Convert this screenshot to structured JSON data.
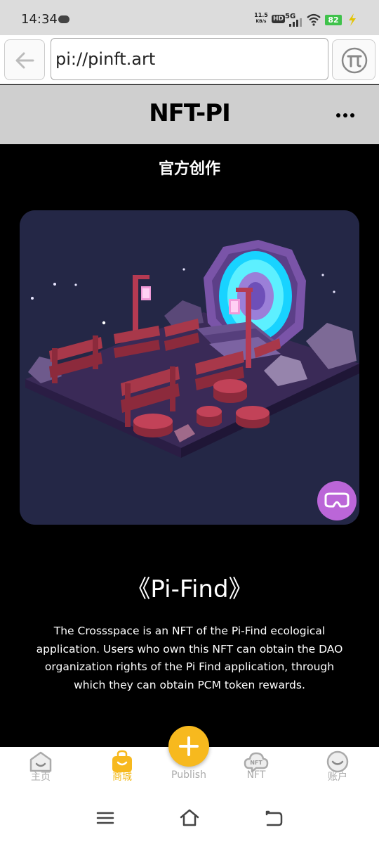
{
  "status_bar": {
    "time": "14:34",
    "net_speed": "11.5",
    "net_unit": "KB/s",
    "hd": "HD",
    "network": "5G",
    "battery": "82",
    "icons": [
      "wechat-icon",
      "signal-icon",
      "wifi-icon",
      "battery-icon",
      "charging-icon"
    ]
  },
  "browser": {
    "url": "pi://pinft.art",
    "back_icon": "back-arrow-icon",
    "pi_icon": "pi-logo-icon"
  },
  "header": {
    "title": "NFT-PI",
    "menu_icon": "more-dots-icon"
  },
  "main": {
    "section_title": "官方创作",
    "nft": {
      "image_icon": "nft-artwork-image",
      "vr_icon": "vr-headset-icon",
      "name": "《Pi-Find》",
      "description": "The Crossspace is an NFT of the Pi-Find ecological application. Users who own this NFT can obtain the DAO organization rights of the Pi Find application, through which they can obtain PCM token rewards."
    },
    "peek_text": "…"
  },
  "tabbar": {
    "items": [
      {
        "label": "主页",
        "icon": "home-face-icon",
        "active": false
      },
      {
        "label": "商城",
        "icon": "shopping-bag-icon",
        "active": true
      },
      {
        "label": "Publish",
        "icon": "plus-icon",
        "active": false
      },
      {
        "label": "NFT",
        "icon": "nft-cloud-icon",
        "active": false
      },
      {
        "label": "账户",
        "icon": "account-face-icon",
        "active": false
      }
    ],
    "active_color": "#f2b817",
    "inactive_color": "#aaaaaa"
  },
  "system_nav": {
    "icons": [
      "menu-lines-icon",
      "home-outline-icon",
      "back-return-icon"
    ]
  }
}
